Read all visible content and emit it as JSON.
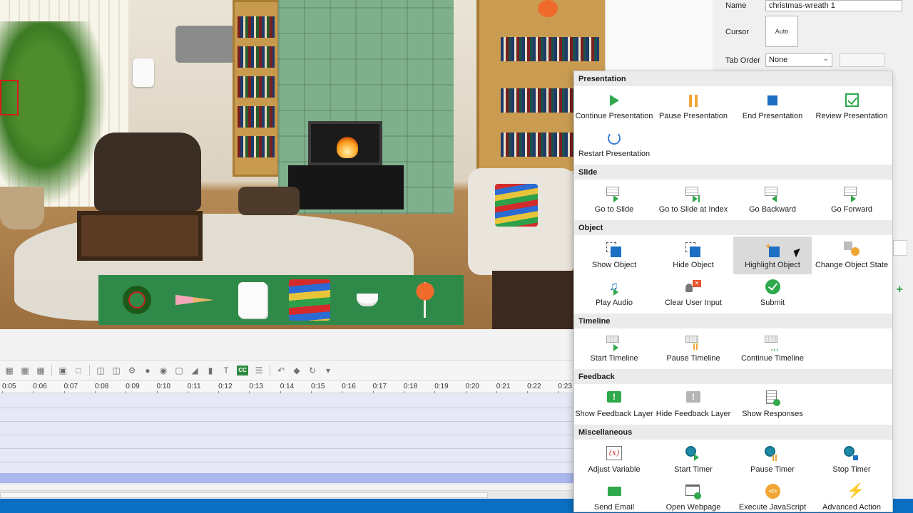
{
  "properties": {
    "name_label": "Name",
    "name_value": "christmas-wreath 1",
    "cursor_label": "Cursor",
    "cursor_value": "Auto",
    "tab_order_label": "Tab Order",
    "tab_order_value": "None"
  },
  "timeline": {
    "ticks": [
      "0:05",
      "0:06",
      "0:07",
      "0:08",
      "0:09",
      "0:10",
      "0:11",
      "0:12",
      "0:13",
      "0:14",
      "0:15",
      "0:16",
      "0:17",
      "0:18",
      "0:19",
      "0:20",
      "0:21",
      "0:22",
      "0:23"
    ]
  },
  "menu": {
    "sections": [
      {
        "title": "Presentation",
        "actions": [
          {
            "label": "Continue Presentation",
            "icon": "play-icon"
          },
          {
            "label": "Pause Presentation",
            "icon": "pause-icon"
          },
          {
            "label": "End Presentation",
            "icon": "stop-icon"
          },
          {
            "label": "Review Presentation",
            "icon": "review-icon"
          },
          {
            "label": "Restart Presentation",
            "icon": "restart-icon"
          }
        ]
      },
      {
        "title": "Slide",
        "actions": [
          {
            "label": "Go to Slide",
            "icon": "go-to-slide-icon"
          },
          {
            "label": "Go to Slide at Index",
            "icon": "go-to-slide-index-icon"
          },
          {
            "label": "Go Backward",
            "icon": "go-backward-icon"
          },
          {
            "label": "Go Forward",
            "icon": "go-forward-icon"
          }
        ]
      },
      {
        "title": "Object",
        "actions": [
          {
            "label": "Show Object",
            "icon": "show-object-icon"
          },
          {
            "label": "Hide Object",
            "icon": "hide-object-icon"
          },
          {
            "label": "Highlight Object",
            "icon": "highlight-object-icon"
          },
          {
            "label": "Change Object State",
            "icon": "change-state-icon"
          },
          {
            "label": "Play Audio",
            "icon": "audio-icon"
          },
          {
            "label": "Clear User Input",
            "icon": "clear-input-icon"
          },
          {
            "label": "Submit",
            "icon": "submit-icon"
          }
        ]
      },
      {
        "title": "Timeline",
        "actions": [
          {
            "label": "Start Timeline",
            "icon": "start-timeline-icon"
          },
          {
            "label": "Pause Timeline",
            "icon": "pause-timeline-icon"
          },
          {
            "label": "Continue Timeline",
            "icon": "continue-timeline-icon"
          }
        ]
      },
      {
        "title": "Feedback",
        "actions": [
          {
            "label": "Show Feedback Layer",
            "icon": "show-feedback-icon"
          },
          {
            "label": "Hide Feedback Layer",
            "icon": "hide-feedback-icon"
          },
          {
            "label": "Show Responses",
            "icon": "responses-icon"
          }
        ]
      },
      {
        "title": "Miscellaneous",
        "actions": [
          {
            "label": "Adjust Variable",
            "icon": "variable-icon"
          },
          {
            "label": "Start Timer",
            "icon": "start-timer-icon"
          },
          {
            "label": "Pause Timer",
            "icon": "pause-timer-icon"
          },
          {
            "label": "Stop Timer",
            "icon": "stop-timer-icon"
          },
          {
            "label": "Send Email",
            "icon": "email-icon"
          },
          {
            "label": "Open Webpage",
            "icon": "webpage-icon"
          },
          {
            "label": "Execute JavaScript",
            "icon": "javascript-icon"
          },
          {
            "label": "Advanced Action",
            "icon": "advanced-action-icon"
          }
        ]
      }
    ],
    "highlighted": "Highlight Object"
  },
  "colors": {
    "accent_green": "#2fa94b",
    "accent_blue": "#1d6fc4",
    "accent_orange": "#f0a534",
    "status_bar": "#0a6fc2",
    "tray_green": "#2f8a4a"
  }
}
